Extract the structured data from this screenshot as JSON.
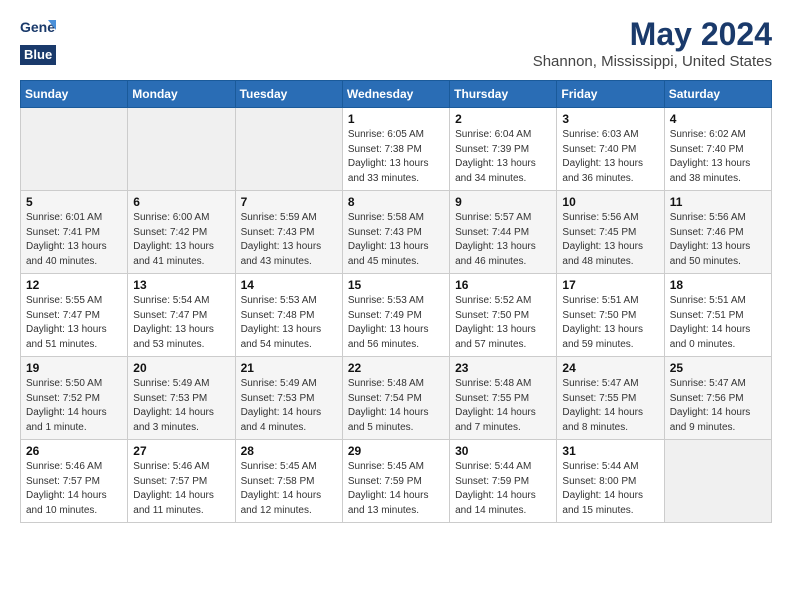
{
  "header": {
    "logo_line1": "General",
    "logo_line2": "Blue",
    "month": "May 2024",
    "location": "Shannon, Mississippi, United States"
  },
  "weekdays": [
    "Sunday",
    "Monday",
    "Tuesday",
    "Wednesday",
    "Thursday",
    "Friday",
    "Saturday"
  ],
  "weeks": [
    [
      {
        "day": "",
        "detail": ""
      },
      {
        "day": "",
        "detail": ""
      },
      {
        "day": "",
        "detail": ""
      },
      {
        "day": "1",
        "detail": "Sunrise: 6:05 AM\nSunset: 7:38 PM\nDaylight: 13 hours\nand 33 minutes."
      },
      {
        "day": "2",
        "detail": "Sunrise: 6:04 AM\nSunset: 7:39 PM\nDaylight: 13 hours\nand 34 minutes."
      },
      {
        "day": "3",
        "detail": "Sunrise: 6:03 AM\nSunset: 7:40 PM\nDaylight: 13 hours\nand 36 minutes."
      },
      {
        "day": "4",
        "detail": "Sunrise: 6:02 AM\nSunset: 7:40 PM\nDaylight: 13 hours\nand 38 minutes."
      }
    ],
    [
      {
        "day": "5",
        "detail": "Sunrise: 6:01 AM\nSunset: 7:41 PM\nDaylight: 13 hours\nand 40 minutes."
      },
      {
        "day": "6",
        "detail": "Sunrise: 6:00 AM\nSunset: 7:42 PM\nDaylight: 13 hours\nand 41 minutes."
      },
      {
        "day": "7",
        "detail": "Sunrise: 5:59 AM\nSunset: 7:43 PM\nDaylight: 13 hours\nand 43 minutes."
      },
      {
        "day": "8",
        "detail": "Sunrise: 5:58 AM\nSunset: 7:43 PM\nDaylight: 13 hours\nand 45 minutes."
      },
      {
        "day": "9",
        "detail": "Sunrise: 5:57 AM\nSunset: 7:44 PM\nDaylight: 13 hours\nand 46 minutes."
      },
      {
        "day": "10",
        "detail": "Sunrise: 5:56 AM\nSunset: 7:45 PM\nDaylight: 13 hours\nand 48 minutes."
      },
      {
        "day": "11",
        "detail": "Sunrise: 5:56 AM\nSunset: 7:46 PM\nDaylight: 13 hours\nand 50 minutes."
      }
    ],
    [
      {
        "day": "12",
        "detail": "Sunrise: 5:55 AM\nSunset: 7:47 PM\nDaylight: 13 hours\nand 51 minutes."
      },
      {
        "day": "13",
        "detail": "Sunrise: 5:54 AM\nSunset: 7:47 PM\nDaylight: 13 hours\nand 53 minutes."
      },
      {
        "day": "14",
        "detail": "Sunrise: 5:53 AM\nSunset: 7:48 PM\nDaylight: 13 hours\nand 54 minutes."
      },
      {
        "day": "15",
        "detail": "Sunrise: 5:53 AM\nSunset: 7:49 PM\nDaylight: 13 hours\nand 56 minutes."
      },
      {
        "day": "16",
        "detail": "Sunrise: 5:52 AM\nSunset: 7:50 PM\nDaylight: 13 hours\nand 57 minutes."
      },
      {
        "day": "17",
        "detail": "Sunrise: 5:51 AM\nSunset: 7:50 PM\nDaylight: 13 hours\nand 59 minutes."
      },
      {
        "day": "18",
        "detail": "Sunrise: 5:51 AM\nSunset: 7:51 PM\nDaylight: 14 hours\nand 0 minutes."
      }
    ],
    [
      {
        "day": "19",
        "detail": "Sunrise: 5:50 AM\nSunset: 7:52 PM\nDaylight: 14 hours\nand 1 minute."
      },
      {
        "day": "20",
        "detail": "Sunrise: 5:49 AM\nSunset: 7:53 PM\nDaylight: 14 hours\nand 3 minutes."
      },
      {
        "day": "21",
        "detail": "Sunrise: 5:49 AM\nSunset: 7:53 PM\nDaylight: 14 hours\nand 4 minutes."
      },
      {
        "day": "22",
        "detail": "Sunrise: 5:48 AM\nSunset: 7:54 PM\nDaylight: 14 hours\nand 5 minutes."
      },
      {
        "day": "23",
        "detail": "Sunrise: 5:48 AM\nSunset: 7:55 PM\nDaylight: 14 hours\nand 7 minutes."
      },
      {
        "day": "24",
        "detail": "Sunrise: 5:47 AM\nSunset: 7:55 PM\nDaylight: 14 hours\nand 8 minutes."
      },
      {
        "day": "25",
        "detail": "Sunrise: 5:47 AM\nSunset: 7:56 PM\nDaylight: 14 hours\nand 9 minutes."
      }
    ],
    [
      {
        "day": "26",
        "detail": "Sunrise: 5:46 AM\nSunset: 7:57 PM\nDaylight: 14 hours\nand 10 minutes."
      },
      {
        "day": "27",
        "detail": "Sunrise: 5:46 AM\nSunset: 7:57 PM\nDaylight: 14 hours\nand 11 minutes."
      },
      {
        "day": "28",
        "detail": "Sunrise: 5:45 AM\nSunset: 7:58 PM\nDaylight: 14 hours\nand 12 minutes."
      },
      {
        "day": "29",
        "detail": "Sunrise: 5:45 AM\nSunset: 7:59 PM\nDaylight: 14 hours\nand 13 minutes."
      },
      {
        "day": "30",
        "detail": "Sunrise: 5:44 AM\nSunset: 7:59 PM\nDaylight: 14 hours\nand 14 minutes."
      },
      {
        "day": "31",
        "detail": "Sunrise: 5:44 AM\nSunset: 8:00 PM\nDaylight: 14 hours\nand 15 minutes."
      },
      {
        "day": "",
        "detail": ""
      }
    ]
  ]
}
